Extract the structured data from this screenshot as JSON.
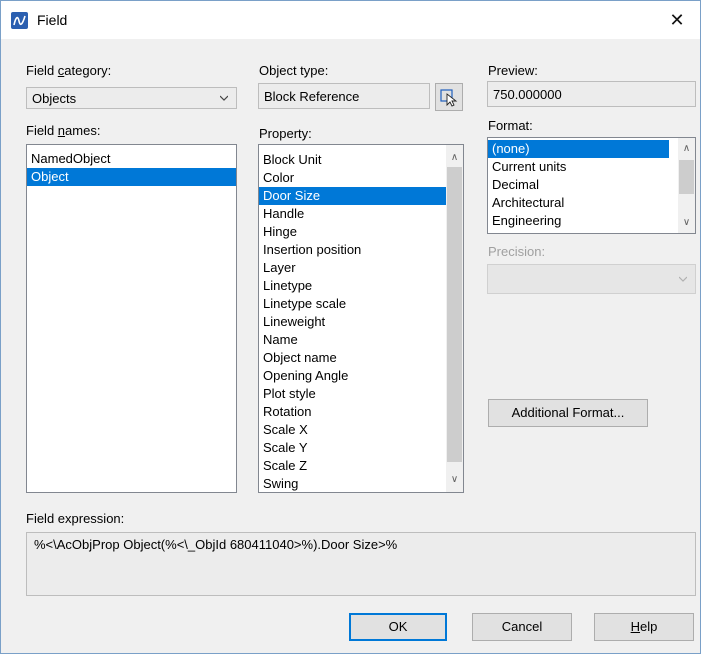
{
  "window": {
    "title": "Field",
    "close_glyph": "✕"
  },
  "field_category": {
    "label_pre": "Field ",
    "label_key": "c",
    "label_post": "ategory:",
    "value": "Objects"
  },
  "field_names": {
    "label_pre": "Field ",
    "label_key": "n",
    "label_post": "ames:",
    "items": [
      {
        "label": "NamedObject"
      },
      {
        "label": "Object"
      }
    ],
    "selected_index": 1
  },
  "object_type": {
    "label": "Object type:",
    "value": "Block Reference",
    "pick_icon": "select-object-icon"
  },
  "property": {
    "label": "Property:",
    "items": [
      "Block Unit",
      "Color",
      "Door Size",
      "Handle",
      "Hinge",
      "Insertion position",
      "Layer",
      "Linetype",
      "Linetype scale",
      "Lineweight",
      "Name",
      "Object name",
      "Opening Angle",
      "Plot style",
      "Rotation",
      "Scale X",
      "Scale Y",
      "Scale Z",
      "Swing"
    ],
    "selected_index": 2
  },
  "preview": {
    "label": "Preview:",
    "value": "750.000000"
  },
  "format": {
    "label": "Format:",
    "items": [
      "(none)",
      "Current units",
      "Decimal",
      "Architectural",
      "Engineering"
    ],
    "selected_index": 0
  },
  "precision": {
    "label": "Precision:",
    "value": ""
  },
  "additional_format": {
    "label": "Additional Format..."
  },
  "field_expression": {
    "label": "Field expression:",
    "value": "%<\\AcObjProp Object(%<\\_ObjId 680411040>%).Door Size>%"
  },
  "buttons": {
    "ok": "OK",
    "cancel": "Cancel",
    "help_key": "H",
    "help_rest": "elp"
  },
  "colors": {
    "selection": "#0078d7",
    "dialog_bg": "#f0f0f0",
    "border": "#7aa0c8"
  }
}
